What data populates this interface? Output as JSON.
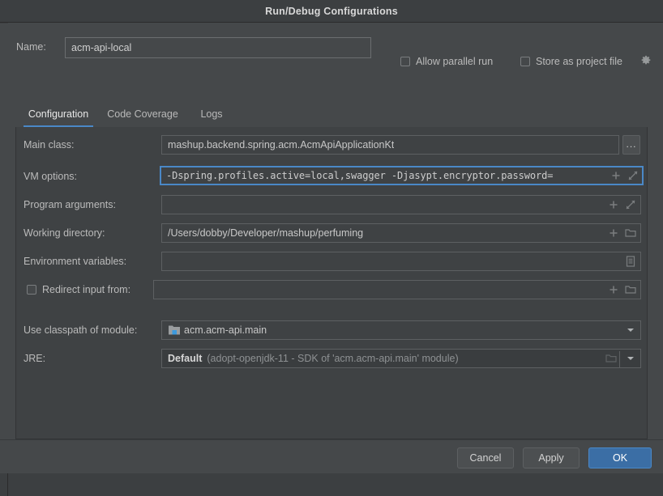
{
  "window": {
    "title": "Run/Debug Configurations"
  },
  "name_row": {
    "label": "Name:",
    "value": "acm-api-local",
    "placeholder": "",
    "allow_parallel_run": {
      "label": "Allow parallel run",
      "checked": false
    },
    "store_as_project_file": {
      "label": "Store as project file",
      "checked": false,
      "gear_icon": "gear-icon"
    }
  },
  "tabs": [
    {
      "label": "Configuration",
      "active": true
    },
    {
      "label": "Code Coverage",
      "active": false
    },
    {
      "label": "Logs",
      "active": false
    }
  ],
  "form": {
    "main_class": {
      "label": "Main class:",
      "value": "mashup.backend.spring.acm.AcmApiApplicationKt",
      "browse_label": "...",
      "browse_icon": "ellipsis-icon"
    },
    "vm_options": {
      "label": "VM options:",
      "value": "-Dspring.profiles.active=local,swagger -Djasypt.encryptor.password=",
      "focused": true,
      "plus_icon": "plus-icon",
      "expand_icon": "expand-diagonal-icon"
    },
    "program_arguments": {
      "label": "Program arguments:",
      "value": "",
      "plus_icon": "plus-icon",
      "expand_icon": "expand-diagonal-icon"
    },
    "working_directory": {
      "label": "Working directory:",
      "value": "/Users/dobby/Developer/mashup/perfuming",
      "plus_icon": "plus-icon",
      "folder_icon": "folder-icon"
    },
    "environment_variables": {
      "label": "Environment variables:",
      "value": "",
      "editor_icon": "document-list-icon"
    },
    "redirect_input_from": {
      "label": "Redirect input from:",
      "checked": false,
      "value": "",
      "plus_icon": "plus-icon",
      "folder_icon": "folder-icon"
    },
    "use_classpath_of_module": {
      "label": "Use classpath of module:",
      "value": "acm.acm-api.main",
      "module_icon": "module-folder-icon",
      "dropdown_icon": "chevron-down-icon"
    },
    "jre": {
      "label": "JRE:",
      "value": "Default",
      "detail": "(adopt-openjdk-11 - SDK of 'acm.acm-api.main' module)",
      "folder_icon": "folder-icon",
      "dropdown_icon": "chevron-down-icon"
    }
  },
  "buttons": {
    "cancel": "Cancel",
    "apply": "Apply",
    "ok": "OK"
  },
  "colors": {
    "titlebar_bg": "#3c3f41",
    "dialog_bg": "#45484a",
    "panel_bg": "#3f4244",
    "accent_blue": "#4a88c7",
    "ok_button_bg": "#3b6ea5",
    "text_primary": "#c8c8c8",
    "text_label": "#bbbbbb",
    "text_muted": "#8e9193",
    "field_border": "#5d6062"
  }
}
